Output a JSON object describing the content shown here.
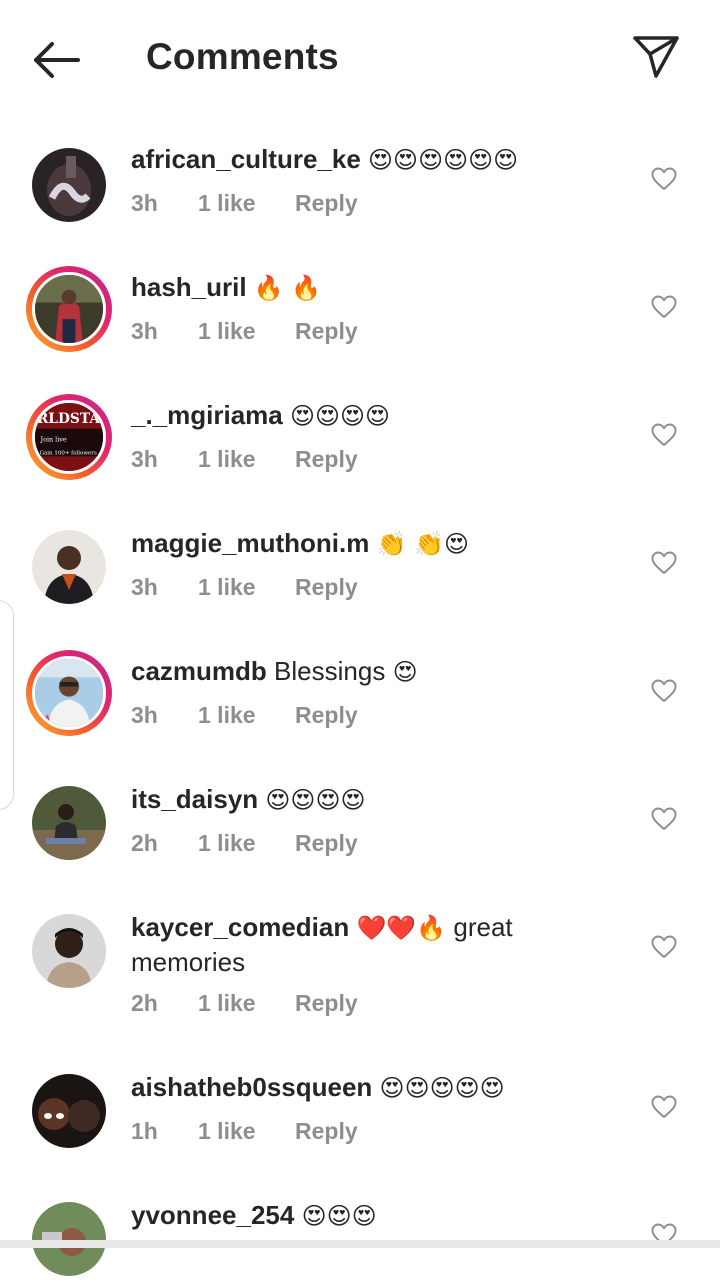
{
  "header": {
    "title": "Comments",
    "back_icon": "arrow-left-icon",
    "share_icon": "send-paper-plane-icon"
  },
  "comments": [
    {
      "username": "african_culture_ke",
      "text": "",
      "emoji": "😍😍😍😍😍😍",
      "time": "3h",
      "likes": "1 like",
      "reply": "Reply"
    },
    {
      "username": "hash_uril",
      "text": "",
      "emoji": "🔥 🔥",
      "time": "3h",
      "likes": "1 like",
      "reply": "Reply"
    },
    {
      "username": "_._mgiriama",
      "text": "",
      "emoji": "😍😍😍😍",
      "time": "3h",
      "likes": "1 like",
      "reply": "Reply"
    },
    {
      "username": "maggie_muthoni.m",
      "text": "",
      "emoji": "👏 👏😍",
      "time": "3h",
      "likes": "1 like",
      "reply": "Reply"
    },
    {
      "username": "cazmumdb",
      "text": "Blessings",
      "emoji": "😍",
      "time": "3h",
      "likes": "1 like",
      "reply": "Reply"
    },
    {
      "username": "its_daisyn",
      "text": "",
      "emoji": "😍😍😍😍",
      "time": "2h",
      "likes": "1 like",
      "reply": "Reply"
    },
    {
      "username": "kaycer_comedian",
      "text": "great memories",
      "emoji": "❤️❤️🔥",
      "time": "2h",
      "likes": "1 like",
      "reply": "Reply"
    },
    {
      "username": "aishatheb0ssqueen",
      "text": "",
      "emoji": "😍😍😍😍😍",
      "time": "1h",
      "likes": "1 like",
      "reply": "Reply"
    },
    {
      "username": "yvonnee_254",
      "text": "",
      "emoji": "😍😍😍",
      "time": "",
      "likes": "",
      "reply": ""
    }
  ],
  "avatar_mgiriama_text": [
    "RLDSTAR",
    "Join live",
    "Gain 100+ followers"
  ],
  "colors": {
    "text": "#262626",
    "meta": "#8e8e8e",
    "story_ring_start": "#f9b13a",
    "story_ring_end": "#c0298e"
  }
}
